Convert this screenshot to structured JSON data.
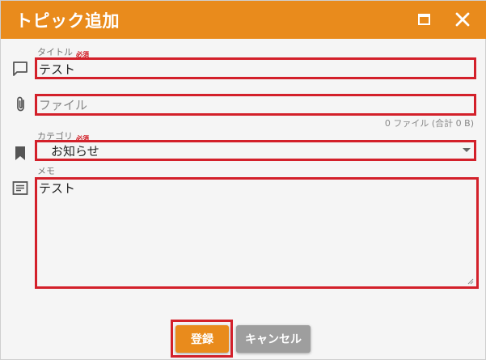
{
  "window": {
    "title": "トピック追加",
    "accent_color": "#e98b1c",
    "highlight_color": "#d3202a"
  },
  "title_field": {
    "label": "タイトル",
    "required_badge": "必須",
    "value": "テスト",
    "icon": "comment-icon"
  },
  "file_field": {
    "placeholder": "ファイル",
    "info": "0 ファイル (合計 0 B)",
    "icon": "paperclip-icon"
  },
  "category_field": {
    "label": "カテゴリ",
    "required_badge": "必須",
    "selected": "お知らせ",
    "icon": "bookmark-icon"
  },
  "memo_field": {
    "label": "メモ",
    "value": "テスト",
    "icon": "notes-icon"
  },
  "buttons": {
    "save_label": "登録",
    "cancel_label": "キャンセル"
  }
}
